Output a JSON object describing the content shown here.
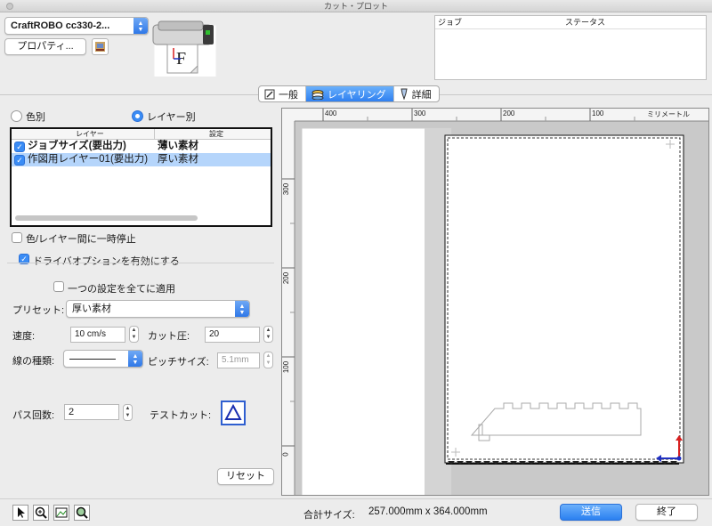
{
  "window": {
    "title": "カット・プロット"
  },
  "printer": {
    "selected": "CraftROBO cc330-2...",
    "properties_label": "プロパティ..."
  },
  "job_list": {
    "col_job": "ジョブ",
    "col_status": "ステータス"
  },
  "tabs": [
    {
      "label": "一般",
      "icon": "general-icon"
    },
    {
      "label": "レイヤリング",
      "icon": "layering-icon",
      "active": true
    },
    {
      "label": "詳細",
      "icon": "detail-icon"
    }
  ],
  "mode": {
    "by_color": "色別",
    "by_layer": "レイヤー別",
    "selected": "by_layer"
  },
  "layer_table": {
    "col_layer": "レイヤー",
    "col_setting": "設定",
    "rows": [
      {
        "name": "ジョブサイズ(要出力)",
        "setting": "薄い素材",
        "checked": true,
        "bold": true
      },
      {
        "name": "作図用レイヤー01(要出力)",
        "setting": "厚い素材",
        "checked": true,
        "selected": true
      }
    ]
  },
  "options": {
    "pause_between": "色/レイヤー間に一時停止",
    "pause_checked": false,
    "enable_driver": "ドライバオプションを有効にする",
    "enable_checked": true,
    "apply_all": "一つの設定を全てに適用",
    "apply_all_checked": false
  },
  "settings": {
    "preset_label": "プリセット:",
    "preset_value": "厚い素材",
    "speed_label": "速度:",
    "speed_value": "10 cm/s",
    "pressure_label": "カット圧:",
    "pressure_value": "20",
    "linetype_label": "線の種類:",
    "pitch_label": "ピッチサイズ:",
    "pitch_value": "5.1mm",
    "passes_label": "パス回数:",
    "passes_value": "2",
    "testcut_label": "テストカット:",
    "reset_label": "リセット"
  },
  "ruler": {
    "unit": "ミリメートル",
    "top_ticks": [
      "400",
      "300",
      "200",
      "100"
    ],
    "left_ticks": [
      "300",
      "200",
      "100",
      "0"
    ]
  },
  "footer": {
    "total_size_label": "合計サイズ:",
    "total_size_value": "257.000mm x 364.000mm",
    "send_label": "送信",
    "close_label": "終了"
  },
  "colors": {
    "accent": "#2f80f0",
    "selection": "#b5d5fb",
    "marker_red": "#d82020",
    "marker_blue": "#2030c0"
  }
}
